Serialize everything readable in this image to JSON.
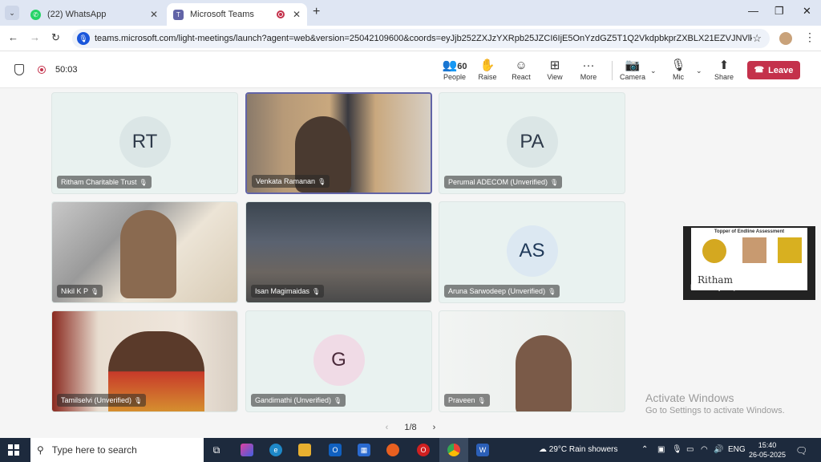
{
  "browser": {
    "tabs": [
      {
        "label": "(22) WhatsApp",
        "active": false
      },
      {
        "label": "Microsoft Teams",
        "active": true
      }
    ],
    "url": "teams.microsoft.com/light-meetings/launch?agent=web&version=25042109600&coords=eyJjb252ZXJzYXRpb25JZCI6IjE5OnYzdGZ5T1Q2VkdpbkprZXBLX21EZVJNVlktUHFXS..."
  },
  "meeting": {
    "timer": "50:03",
    "people_count": "60",
    "buttons": {
      "people": "People",
      "raise": "Raise",
      "react": "React",
      "view": "View",
      "more": "More",
      "camera": "Camera",
      "mic": "Mic",
      "share": "Share",
      "leave": "Leave"
    }
  },
  "participants": [
    {
      "name": "Ritham Charitable Trust",
      "initials": "RT"
    },
    {
      "name": "Venkata Ramanan",
      "initials": ""
    },
    {
      "name": "Perumal ADECOM (Unverified)",
      "initials": "PA"
    },
    {
      "name": "Nikil K P",
      "initials": ""
    },
    {
      "name": "Isan Magimaidas",
      "initials": ""
    },
    {
      "name": "Aruna Sarwodeep (Unverified)",
      "initials": "AS"
    },
    {
      "name": "Tamilselvi (Unverified)",
      "initials": ""
    },
    {
      "name": "Gandimathi (Unverified)",
      "initials": "G"
    },
    {
      "name": "Praveen",
      "initials": ""
    }
  ],
  "side_tile": {
    "name": "Mohanraj A",
    "slide_title": "Topper of Endline Assessment",
    "slide_logo": "Ritham"
  },
  "pager": {
    "text": "1/8"
  },
  "watermark": {
    "line1": "Activate Windows",
    "line2": "Go to Settings to activate Windows."
  },
  "taskbar": {
    "search_placeholder": "Type here to search",
    "weather": "29°C  Rain showers",
    "lang": "ENG",
    "time": "15:40",
    "date": "26-05-2025"
  },
  "colors": {
    "accent": "#6264a7",
    "leave": "#c4314b"
  }
}
